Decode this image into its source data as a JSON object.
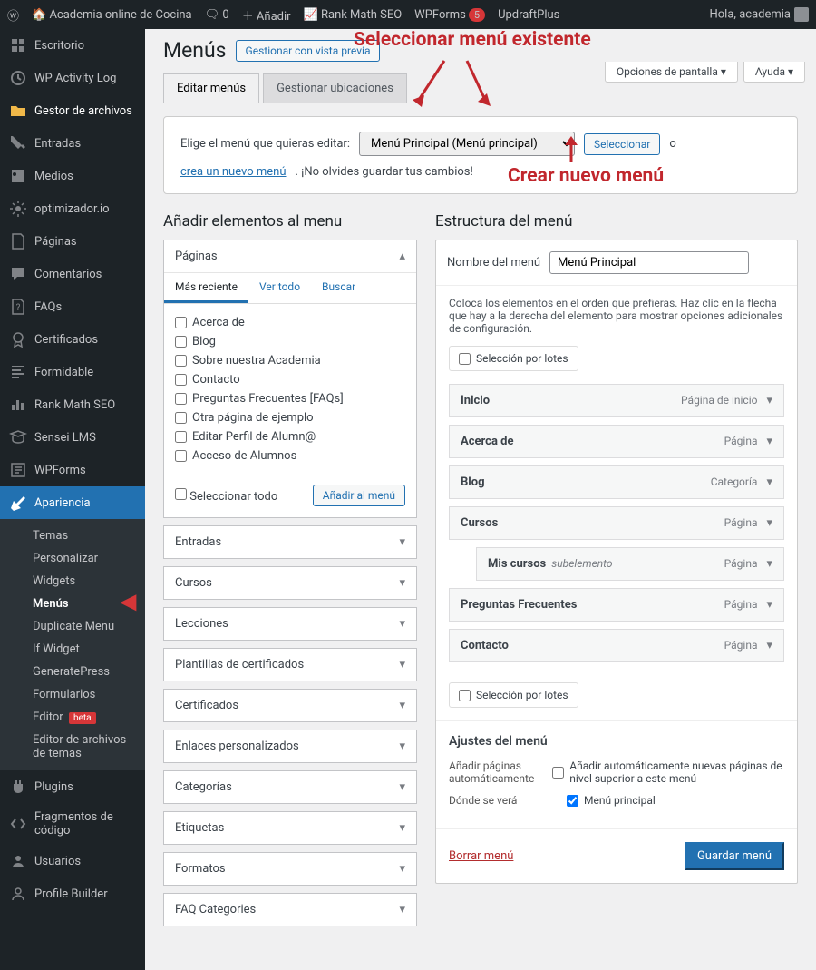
{
  "adminBar": {
    "siteName": "Academia online de Cocina",
    "comments": "0",
    "addNew": "Añadir",
    "rankMath": "Rank Math SEO",
    "wpforms": "WPForms",
    "wpformsCount": "5",
    "updraft": "UpdraftPlus",
    "greeting": "Hola, academia"
  },
  "screenOptions": {
    "options": "Opciones de pantalla",
    "help": "Ayuda"
  },
  "sidebar": {
    "items": [
      {
        "label": "Escritorio"
      },
      {
        "label": "WP Activity Log"
      },
      {
        "label": "Gestor de archivos"
      },
      {
        "label": "Entradas"
      },
      {
        "label": "Medios"
      },
      {
        "label": "optimizador.io"
      },
      {
        "label": "Páginas"
      },
      {
        "label": "Comentarios"
      },
      {
        "label": "FAQs"
      },
      {
        "label": "Certificados"
      },
      {
        "label": "Formidable"
      },
      {
        "label": "Rank Math SEO"
      },
      {
        "label": "Sensei LMS"
      },
      {
        "label": "WPForms"
      },
      {
        "label": "Apariencia"
      },
      {
        "label": "Plugins"
      },
      {
        "label": "Fragmentos de código"
      },
      {
        "label": "Usuarios"
      },
      {
        "label": "Profile Builder"
      }
    ],
    "appearanceSub": [
      "Temas",
      "Personalizar",
      "Widgets",
      "Menús",
      "Duplicate Menu",
      "If Widget",
      "GeneratePress",
      "Formularios",
      "Editor",
      "Editor de archivos de temas"
    ],
    "betaBadge": "beta"
  },
  "page": {
    "title": "Menús",
    "managePreview": "Gestionar con vista previa",
    "tabs": {
      "edit": "Editar menús",
      "locations": "Gestionar ubicaciones"
    },
    "selectBox": {
      "prompt": "Elige el menú que quieras editar:",
      "menuOption": "Menú Principal (Menú principal)",
      "selectBtn": "Seleccionar",
      "or": "o",
      "createNew": "crea un nuevo menú",
      "reminder": ". ¡No olvides guardar tus cambios!"
    },
    "addHeading": "Añadir elementos al menu",
    "structureHeading": "Estructura del menú",
    "panels": {
      "pages": "Páginas",
      "entries": "Entradas",
      "courses": "Cursos",
      "lessons": "Lecciones",
      "certTemplates": "Plantillas de certificados",
      "certificates": "Certificados",
      "customLinks": "Enlaces personalizados",
      "categories": "Categorías",
      "tags": "Etiquetas",
      "formats": "Formatos",
      "faqCategories": "FAQ Categories"
    },
    "pagesPanel": {
      "tabs": {
        "recent": "Más reciente",
        "viewAll": "Ver todo",
        "search": "Buscar"
      },
      "items": [
        "Acerca de",
        "Blog",
        "Sobre nuestra Academia",
        "Contacto",
        "Preguntas Frecuentes [FAQs]",
        "Otra página de ejemplo",
        "Editar Perfil de Alumn@",
        "Acceso de Alumnos"
      ],
      "selectAll": "Seleccionar todo",
      "addBtn": "Añadir al menú"
    },
    "menuEdit": {
      "nameLabel": "Nombre del menú",
      "nameValue": "Menú Principal",
      "instructions": "Coloca los elementos en el orden que prefieras. Haz clic en la flecha que hay a la derecha del elemento para mostrar opciones adicionales de configuración.",
      "bulkSelect": "Selección por lotes",
      "items": [
        {
          "title": "Inicio",
          "type": "Página de inicio"
        },
        {
          "title": "Acerca de",
          "type": "Página"
        },
        {
          "title": "Blog",
          "type": "Categoría"
        },
        {
          "title": "Cursos",
          "type": "Página"
        },
        {
          "title": "Mis cursos",
          "type": "Página",
          "sub": true,
          "subLabel": "subelemento"
        },
        {
          "title": "Preguntas Frecuentes",
          "type": "Página"
        },
        {
          "title": "Contacto",
          "type": "Página"
        }
      ],
      "settings": {
        "heading": "Ajustes del menú",
        "autoAddLabel": "Añadir páginas automáticamente",
        "autoAddDesc": "Añadir automáticamente nuevas páginas de nivel superior a este menú",
        "locationLabel": "Dónde se verá",
        "locationDesc": "Menú principal"
      },
      "delete": "Borrar menú",
      "save": "Guardar menú"
    }
  },
  "annotations": {
    "selectExisting": "Seleccionar menú existente",
    "createNew": "Crear nuevo menú"
  }
}
